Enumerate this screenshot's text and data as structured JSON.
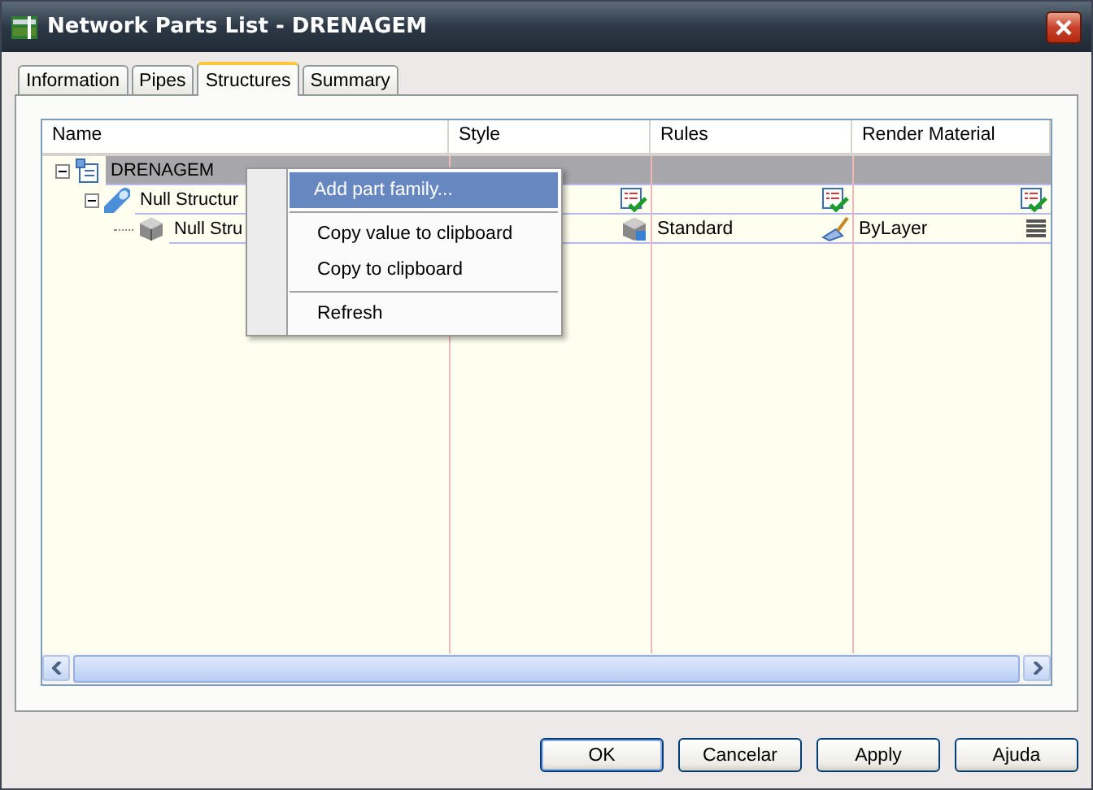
{
  "window": {
    "title": "Network Parts List - DRENAGEM"
  },
  "tabs": [
    {
      "label": "Information",
      "selected": false
    },
    {
      "label": "Pipes",
      "selected": false
    },
    {
      "label": "Structures",
      "selected": true
    },
    {
      "label": "Summary",
      "selected": false
    }
  ],
  "table": {
    "columns": [
      "Name",
      "Style",
      "Rules",
      "Render Material"
    ],
    "tree": [
      {
        "name": "DRENAGEM",
        "selected": true,
        "expanded": true,
        "cells": [
          "",
          "",
          ""
        ],
        "children": [
          {
            "name": "Null Structur",
            "selected": false,
            "expanded": true,
            "cells": [
              "",
              "",
              ""
            ],
            "children": [
              {
                "name": "Null Stru",
                "selected": false,
                "cells": [
                  "",
                  "Standard",
                  "ByLayer"
                ]
              }
            ]
          }
        ]
      }
    ]
  },
  "context_menu": {
    "items": [
      {
        "label": "Add part family...",
        "selected": true
      },
      {
        "label": "Copy value to clipboard",
        "selected": false
      },
      {
        "label": "Copy to clipboard",
        "selected": false
      },
      {
        "label": "Refresh",
        "selected": false
      }
    ]
  },
  "buttons": [
    {
      "label": "OK",
      "kind": "default"
    },
    {
      "label": "Cancelar",
      "kind": "normal"
    },
    {
      "label": "Apply",
      "kind": "normal"
    },
    {
      "label": "Ajuda",
      "kind": "normal"
    }
  ]
}
